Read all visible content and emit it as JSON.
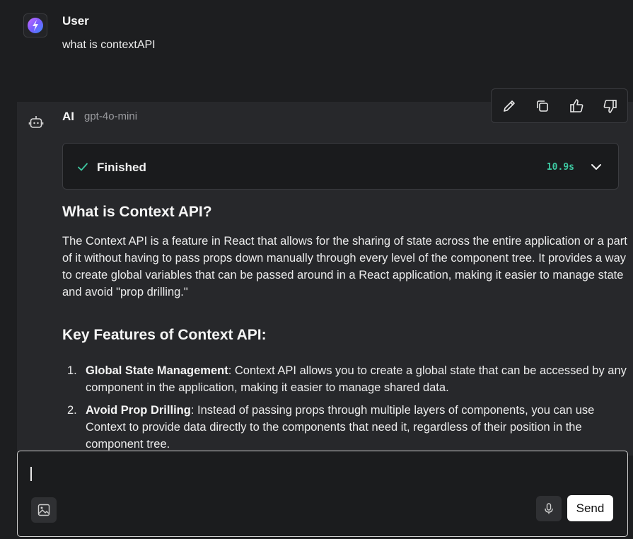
{
  "user_message": {
    "author": "User",
    "text": "what is contextAPI"
  },
  "ai_message": {
    "author": "AI",
    "model": "gpt-4o-mini",
    "status": {
      "label": "Finished",
      "duration": "10.9s"
    },
    "heading": "What is Context API?",
    "paragraph": "The Context API is a feature in React that allows for the sharing of state across the entire application or a part of it without having to pass props down manually through every level of the component tree. It provides a way to create global variables that can be passed around in a React application, making it easier to manage state and avoid \"prop drilling.\"",
    "subheading": "Key Features of Context API:",
    "features": [
      {
        "number": "1.",
        "title": "Global State Management",
        "text": ": Context API allows you to create a global state that can be accessed by any component in the application, making it easier to manage shared data."
      },
      {
        "number": "2.",
        "title": "Avoid Prop Drilling",
        "text": ": Instead of passing props through multiple layers of components, you can use Context to provide data directly to the components that need it, regardless of their position in the component tree."
      }
    ]
  },
  "toolbar": {
    "icons": [
      "pencil-icon",
      "copy-icon",
      "thumbs-up-icon",
      "thumbs-down-icon"
    ]
  },
  "composer": {
    "value": "",
    "send_label": "Send"
  },
  "colors": {
    "background": "#1d1e20",
    "ai_block": "#27282b",
    "accent_timer": "#3ec9a2",
    "send_button": "#ffffff"
  }
}
